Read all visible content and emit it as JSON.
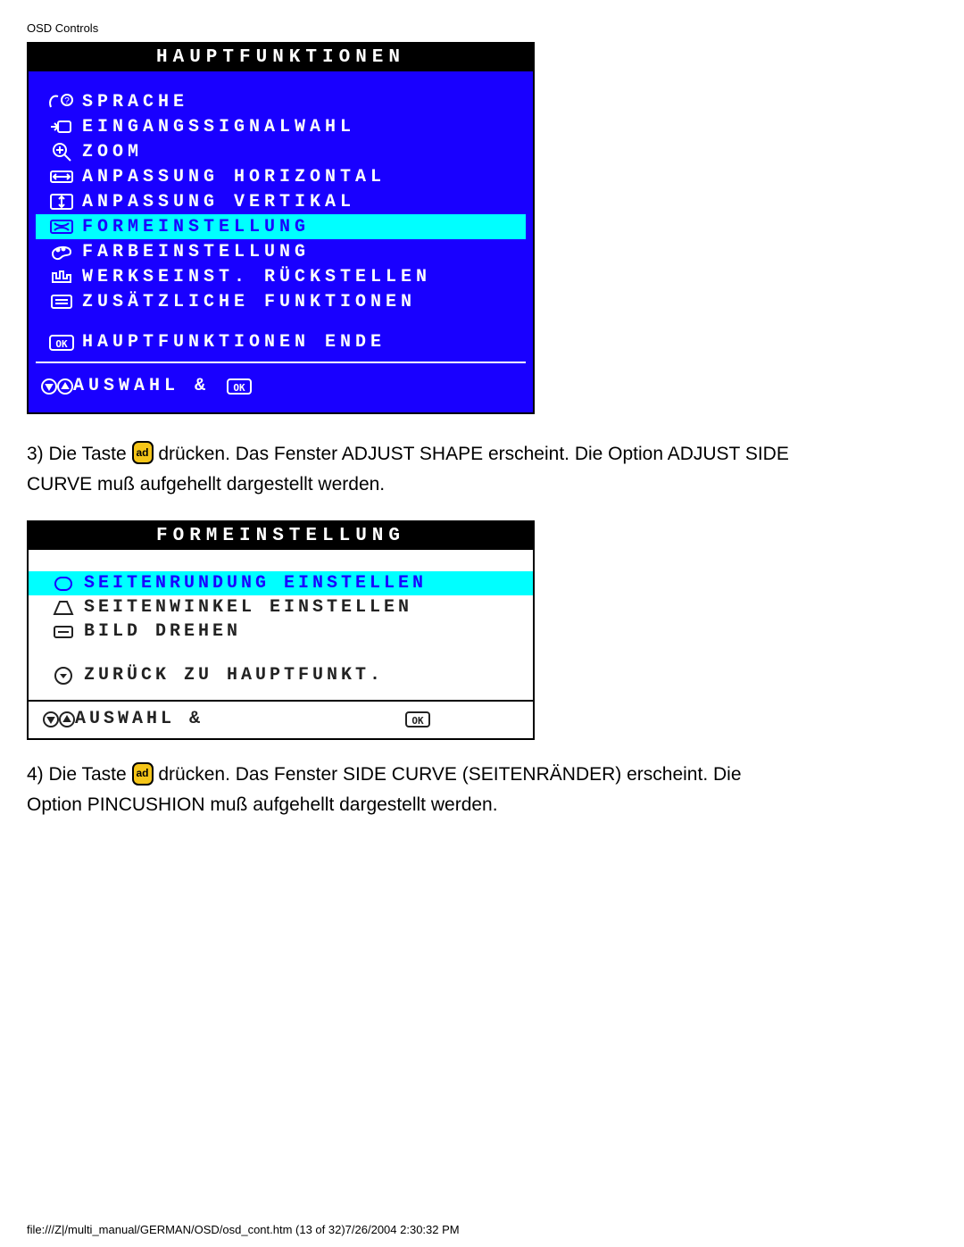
{
  "header": "OSD Controls",
  "osd_main": {
    "title": "HAUPTFUNKTIONEN",
    "items": [
      {
        "label": "SPRACHE",
        "hl": false
      },
      {
        "label": "EINGANGSSIGNALWAHL",
        "hl": false
      },
      {
        "label": "ZOOM",
        "hl": false
      },
      {
        "label": "ANPASSUNG HORIZONTAL",
        "hl": false
      },
      {
        "label": "ANPASSUNG VERTIKAL",
        "hl": false
      },
      {
        "label": "FORMEINSTELLUNG",
        "hl": true
      },
      {
        "label": "FARBEINSTELLUNG",
        "hl": false
      },
      {
        "label": "WERKSEINST. RÜCKSTELLEN",
        "hl": false
      },
      {
        "label": "ZUSÄTZLICHE FUNKTIONEN",
        "hl": false
      }
    ],
    "end_label": "HAUPTFUNKTIONEN ENDE",
    "footer_select": "AUSWAHL &"
  },
  "instruction3_a": "3) Die Taste ",
  "instruction3_b": " drücken. Das Fenster ADJUST SHAPE erscheint. Die Option ADJUST SIDE CURVE muß aufgehellt dargestellt werden.",
  "osd_shape": {
    "title": "FORMEINSTELLUNG",
    "items": [
      {
        "label": "SEITENRUNDUNG EINSTELLEN",
        "hl": true
      },
      {
        "label": "SEITENWINKEL EINSTELLEN",
        "hl": false
      },
      {
        "label": "BILD DREHEN",
        "hl": false
      }
    ],
    "back_label": "ZURÜCK ZU HAUPTFUNKT.",
    "footer_select": "AUSWAHL &"
  },
  "instruction4_a": "4) Die Taste ",
  "instruction4_b": " drücken. Das Fenster SIDE CURVE (SEITENRÄNDER) erscheint. Die Option PINCUSHION muß aufgehellt dargestellt werden.",
  "ok_label": "ad",
  "footer": "file:///Z|/multi_manual/GERMAN/OSD/osd_cont.htm (13 of 32)7/26/2004 2:30:32 PM"
}
